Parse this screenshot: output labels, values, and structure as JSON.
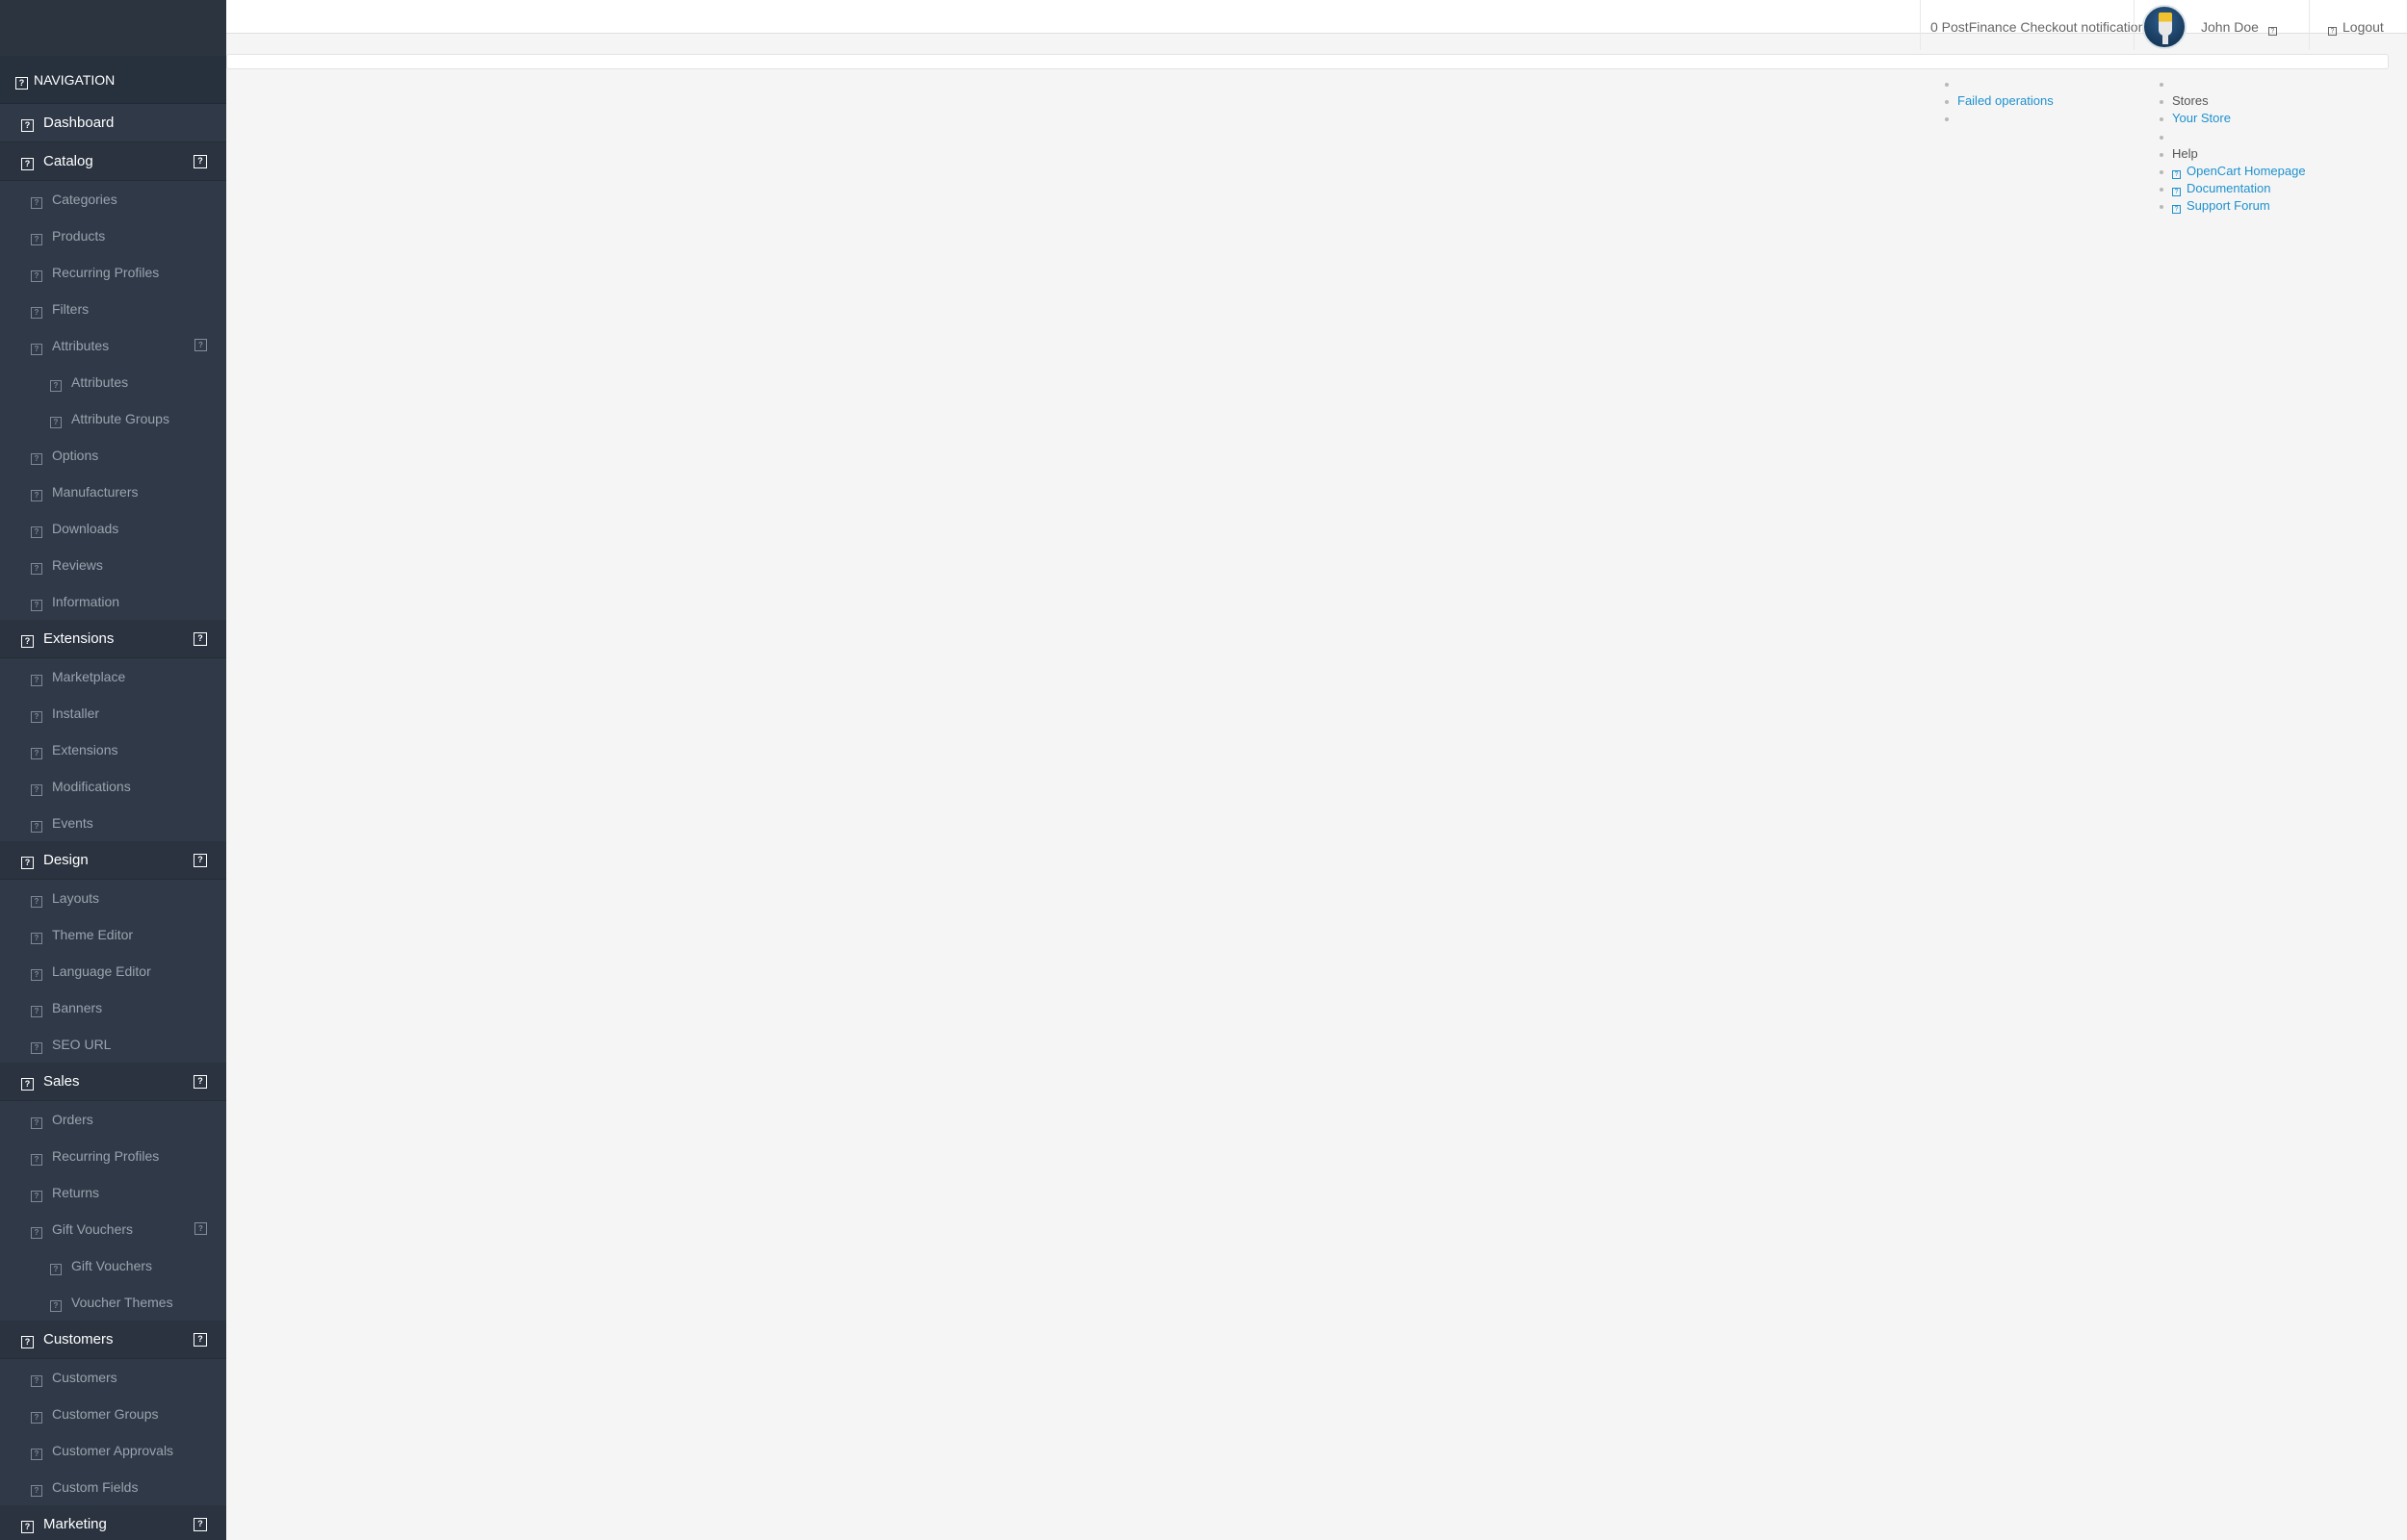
{
  "header": {
    "notifications_label": "0 PostFinance Checkout notifications",
    "user_name": "John Doe",
    "logout_label": "Logout"
  },
  "notifications_dropdown": {
    "items": [
      "",
      "Failed operations",
      ""
    ]
  },
  "store_dropdown": {
    "stores_header": "Stores",
    "store_link": "Your Store",
    "help_header": "Help",
    "help_links": [
      "OpenCart Homepage",
      "Documentation",
      "Support Forum"
    ]
  },
  "sidebar": {
    "heading": "NAVIGATION",
    "dashboard": "Dashboard",
    "catalog": {
      "label": "Catalog",
      "items": [
        "Categories",
        "Products",
        "Recurring Profiles",
        "Filters"
      ],
      "attributes": {
        "label": "Attributes",
        "children": [
          "Attributes",
          "Attribute Groups"
        ]
      },
      "items_after": [
        "Options",
        "Manufacturers",
        "Downloads",
        "Reviews",
        "Information"
      ]
    },
    "extensions": {
      "label": "Extensions",
      "items": [
        "Marketplace",
        "Installer",
        "Extensions",
        "Modifications",
        "Events"
      ]
    },
    "design": {
      "label": "Design",
      "items": [
        "Layouts",
        "Theme Editor",
        "Language Editor",
        "Banners",
        "SEO URL"
      ]
    },
    "sales": {
      "label": "Sales",
      "items": [
        "Orders",
        "Recurring Profiles",
        "Returns"
      ],
      "gift_vouchers": {
        "label": "Gift Vouchers",
        "children": [
          "Gift Vouchers",
          "Voucher Themes"
        ]
      }
    },
    "customers": {
      "label": "Customers",
      "items": [
        "Customers",
        "Customer Groups",
        "Customer Approvals",
        "Custom Fields"
      ]
    },
    "marketing": {
      "label": "Marketing"
    }
  },
  "colors": {
    "sidebar_bg": "#2f3947",
    "header_bg": "#ffffff",
    "content_bg": "#f5f5f5",
    "link": "#1e91cf"
  }
}
